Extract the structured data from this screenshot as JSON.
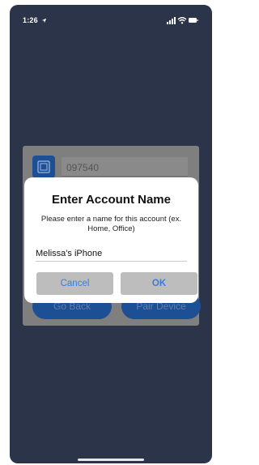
{
  "status_bar": {
    "time": "1:26",
    "location_icon": "location-arrow-icon",
    "signal_icon": "cellular-signal-icon",
    "wifi_icon": "wifi-icon",
    "battery_icon": "battery-icon"
  },
  "background_card": {
    "device_icon": "device-icon",
    "code": "097540",
    "back_label": "Go Back",
    "pair_label": "Pair Device"
  },
  "dialog": {
    "title": "Enter Account Name",
    "message": "Please enter a name for this account (ex. Home, Office)",
    "input_value": "Melissa's iPhone",
    "cancel_label": "Cancel",
    "ok_label": "OK"
  },
  "colors": {
    "screen_background": "#2b3449",
    "accent_blue": "#1d4f95",
    "link_blue": "#3b7be0",
    "dim_overlay": "#7f7f7f"
  }
}
